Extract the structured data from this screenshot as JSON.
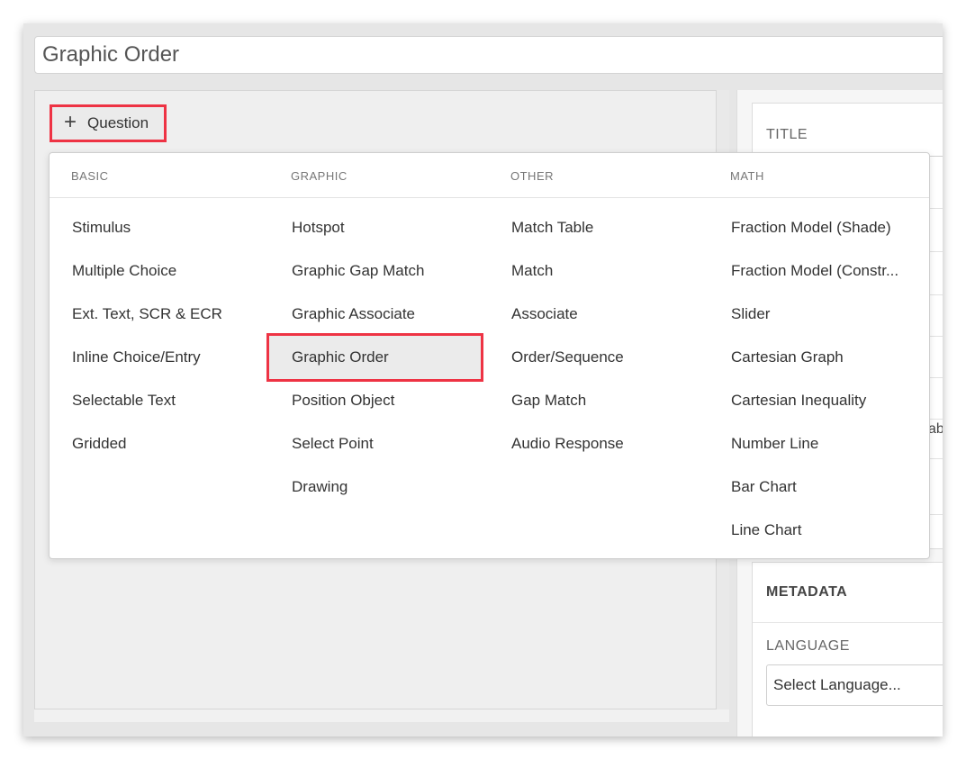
{
  "document_title": "Graphic Order",
  "add_question": {
    "label": "Question"
  },
  "menu": {
    "columns": [
      {
        "header": "BASIC",
        "items": [
          "Stimulus",
          "Multiple Choice",
          "Ext. Text, SCR & ECR",
          "Inline Choice/Entry",
          "Selectable Text",
          "Gridded"
        ]
      },
      {
        "header": "GRAPHIC",
        "items": [
          "Hotspot",
          "Graphic Gap Match",
          "Graphic Associate",
          "Graphic Order",
          "Position Object",
          "Select Point",
          "Drawing"
        ]
      },
      {
        "header": "OTHER",
        "items": [
          "Match Table",
          "Match",
          "Associate",
          "Order/Sequence",
          "Gap Match",
          "Audio Response"
        ]
      },
      {
        "header": "MATH",
        "items": [
          "Fraction Model (Shade)",
          "Fraction Model (Constr...",
          "Slider",
          "Cartesian Graph",
          "Cartesian Inequality",
          "Number Line",
          "Bar Chart",
          "Line Chart"
        ]
      }
    ],
    "selected_item": "Graphic Order"
  },
  "properties": {
    "title_label": "TITLE",
    "peek_text": "ab"
  },
  "metadata": {
    "header": "METADATA",
    "language_label": "LANGUAGE",
    "language_value": "Select Language..."
  },
  "colors": {
    "highlight_border": "#ee3344",
    "selected_bg": "#ebebeb"
  }
}
